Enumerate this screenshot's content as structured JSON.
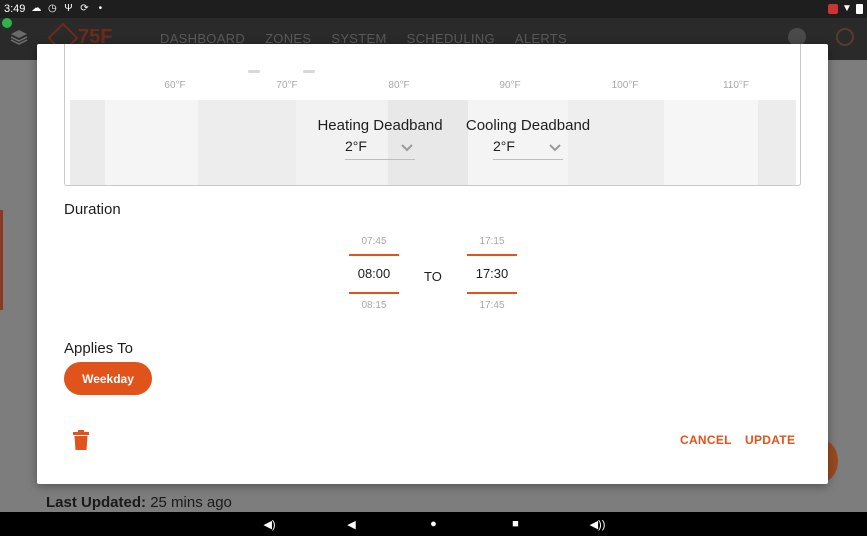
{
  "status_bar": {
    "time": "3:49",
    "icons_left": [
      "cloud-icon",
      "clock-icon",
      "usb-icon",
      "sync-icon",
      "dot-icon"
    ],
    "icons_right": [
      "notification-icon",
      "wifi-icon",
      "battery-icon"
    ]
  },
  "app_bar": {
    "logo_text": "75F",
    "nav_items": [
      "DASHBOARD",
      "ZONES",
      "SYSTEM",
      "SCHEDULING",
      "ALERTS"
    ],
    "icons": [
      "layers-icon",
      "gear-icon",
      "gauge-icon"
    ]
  },
  "dialog": {
    "temperature_scale": [
      "60°F",
      "70°F",
      "80°F",
      "90°F",
      "100°F",
      "110°F"
    ],
    "heating_deadband": {
      "label": "Heating Deadband",
      "value": "2°F"
    },
    "cooling_deadband": {
      "label": "Cooling Deadband",
      "value": "2°F"
    },
    "duration": {
      "title": "Duration",
      "start": {
        "prev": "07:45",
        "value": "08:00",
        "next": "08:15"
      },
      "separator": "TO",
      "end": {
        "prev": "17:15",
        "value": "17:30",
        "next": "17:45"
      }
    },
    "applies_to": {
      "title": "Applies To",
      "chip": "Weekday"
    },
    "actions": {
      "cancel": "CANCEL",
      "update": "UPDATE"
    }
  },
  "background": {
    "last_updated_label": "Last Updated:",
    "last_updated_value": "25 mins ago"
  },
  "colors": {
    "accent": "#e0531a",
    "status_bar": "#1e1e1e",
    "nav_bar": "#000000"
  }
}
